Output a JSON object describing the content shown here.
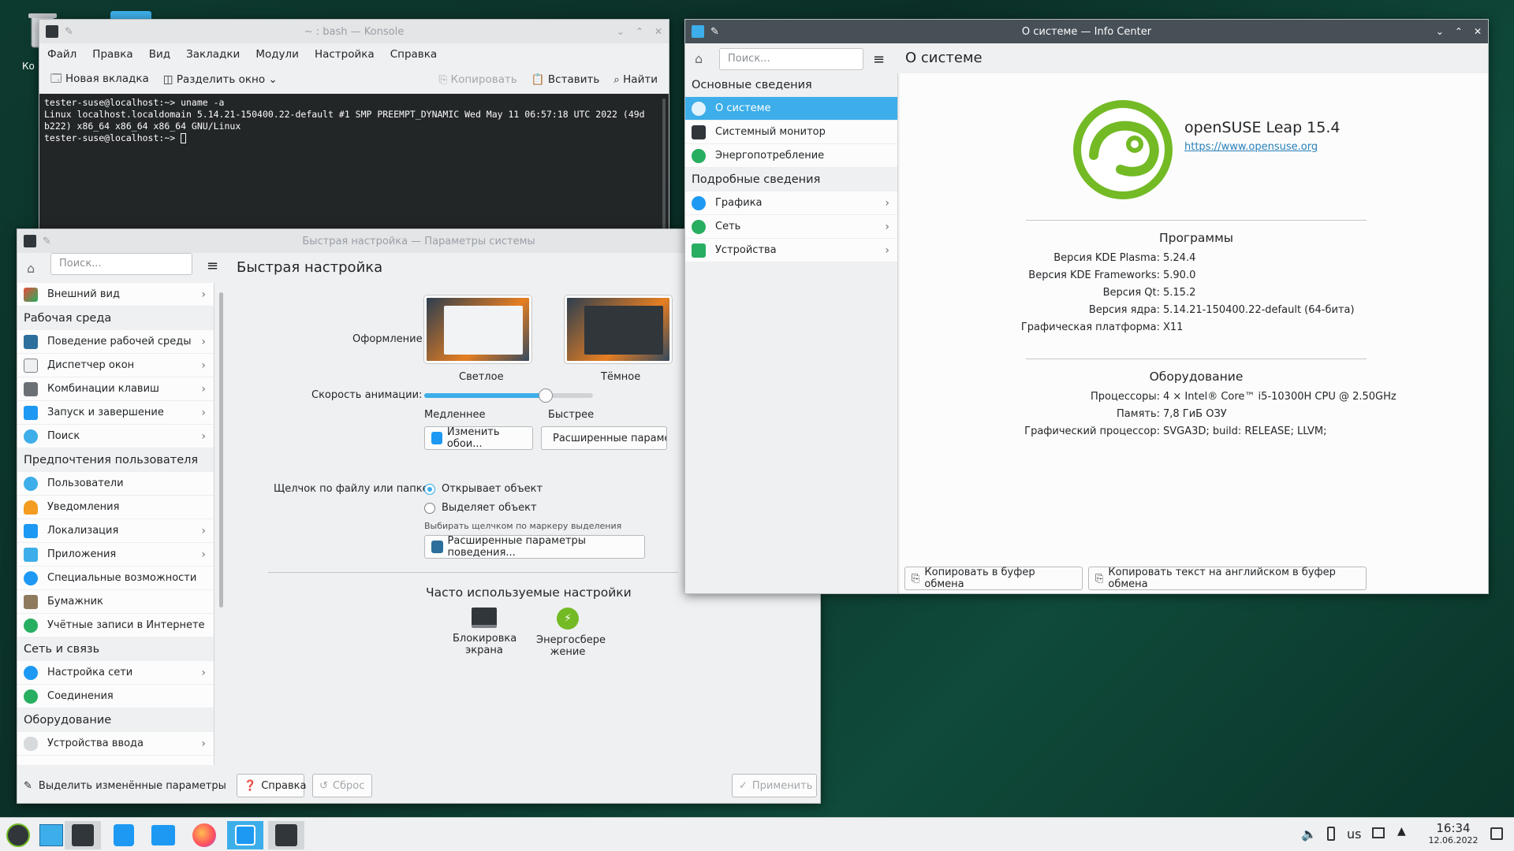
{
  "desktop": {
    "home_label": "Ко"
  },
  "konsole": {
    "title": "~ : bash — Konsole",
    "menu": [
      "Файл",
      "Правка",
      "Вид",
      "Закладки",
      "Модули",
      "Настройка",
      "Справка"
    ],
    "new_tab": "Новая вкладка",
    "split": "Разделить окно",
    "copy": "Копировать",
    "paste": "Вставить",
    "find": "Найти",
    "output": "tester-suse@localhost:~> uname -a\nLinux localhost.localdomain 5.14.21-150400.22-default #1 SMP PREEMPT_DYNAMIC Wed May 11 06:57:18 UTC 2022 (49d\nb222) x86_64 x86_64 x86_64 GNU/Linux\ntester-suse@localhost:~> "
  },
  "settings": {
    "title": "Быстрая настройка — Параметры системы",
    "search_placeholder": "Поиск...",
    "page_title": "Быстрая настройка",
    "sidebar": {
      "appearance": "Внешний вид",
      "workspace_header": "Рабочая среда",
      "workspace_behavior": "Поведение рабочей среды",
      "window_manager": "Диспетчер окон",
      "shortcuts": "Комбинации клавиш",
      "startup": "Запуск и завершение",
      "search": "Поиск",
      "prefs_header": "Предпочтения пользователя",
      "users": "Пользователи",
      "notifications": "Уведомления",
      "locale": "Локализация",
      "apps": "Приложения",
      "accessibility": "Специальные возможности",
      "wallet": "Бумажник",
      "accounts": "Учётные записи в Интернете",
      "network_header": "Сеть и связь",
      "network_settings": "Настройка сети",
      "connections": "Соединения",
      "hardware_header": "Оборудование",
      "input_devices": "Устройства ввода"
    },
    "theme_label": "Оформление:",
    "theme_light": "Светлое",
    "theme_dark": "Тёмное",
    "anim_label": "Скорость анимации:",
    "anim_slow": "Медленнее",
    "anim_fast": "Быстрее",
    "anim_value": 0.72,
    "change_wallpaper": "Изменить обои...",
    "advanced_appearance": "Расширенные параметры",
    "click_label": "Щелчок по файлу или папке:",
    "click_open": "Открывает объект",
    "click_select": "Выделяет объект",
    "click_hint": "Выбирать щелчком по маркеру выделения",
    "advanced_behavior": "Расширенные параметры поведения...",
    "frequent_title": "Часто используемые настройки",
    "frequent_lock_1": "Блокировка",
    "frequent_lock_2": "экрана",
    "frequent_power_1": "Энергосбере",
    "frequent_power_2": "жение",
    "highlight_changed": "Выделить изменённые параметры",
    "help": "Справка",
    "reset": "Сброс",
    "apply": "Применить"
  },
  "infocenter": {
    "title": "О системе — Info Center",
    "search_placeholder": "Поиск...",
    "page_title": "О системе",
    "basic_header": "Основные сведения",
    "about": "О системе",
    "sysmon": "Системный монитор",
    "energy": "Энергопотребление",
    "detailed_header": "Подробные сведения",
    "graphics": "Графика",
    "network": "Сеть",
    "devices": "Устройства",
    "distro": "openSUSE Leap 15.4",
    "url": "https://www.opensuse.org",
    "software_header": "Программы",
    "software": [
      {
        "k": "Версия KDE Plasma:",
        "v": "5.24.4"
      },
      {
        "k": "Версия KDE Frameworks:",
        "v": "5.90.0"
      },
      {
        "k": "Версия Qt:",
        "v": "5.15.2"
      },
      {
        "k": "Версия ядра:",
        "v": "5.14.21-150400.22-default (64-бита)"
      },
      {
        "k": "Графическая платформа:",
        "v": "X11"
      }
    ],
    "hardware_header": "Оборудование",
    "hardware": [
      {
        "k": "Процессоры:",
        "v": "4 × Intel® Core™ i5-10300H CPU @ 2.50GHz"
      },
      {
        "k": "Память:",
        "v": "7,8 ГиБ ОЗУ"
      },
      {
        "k": "Графический процессор:",
        "v": "SVGA3D; build: RELEASE; LLVM;"
      }
    ],
    "copy_clipboard": "Копировать в буфер обмена",
    "copy_english": "Копировать текст на английском в буфер обмена"
  },
  "taskbar": {
    "keyboard_layout": "us",
    "time": "16:34",
    "date": "12.06.2022"
  },
  "colors": {
    "accent": "#3daee9",
    "suse_green": "#73ba25",
    "terminal_bg": "#232627"
  }
}
